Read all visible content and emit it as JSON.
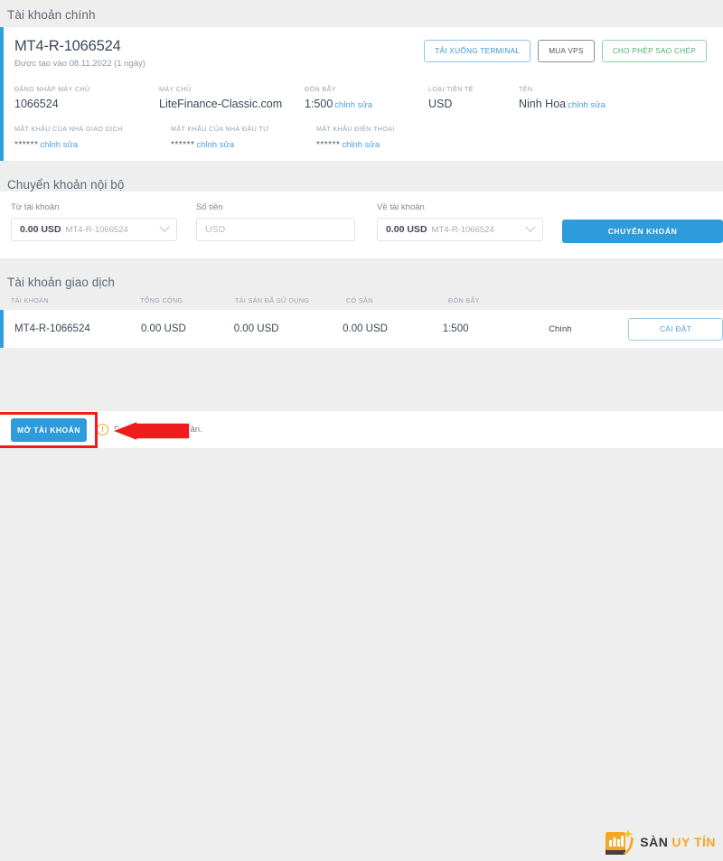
{
  "page": {
    "main_account_title": "Tài khoản chính",
    "transfer_title": "Chuyển khoản nội bộ",
    "accounts_title": "Tài khoản giao dịch"
  },
  "colors": {
    "accent_blue": "#2e9bda",
    "card_border_blue": "#2f9fe0",
    "link_blue": "#4a9fe0",
    "green_outline": "#8ed3a6",
    "annotation_red": "#ee1c1c",
    "warning_orange": "#f0a818",
    "brand_orange": "#f5a623"
  },
  "main_account": {
    "account_number": "MT4-R-1066524",
    "created": "Được tạo vào 08.11.2022 (1 ngày)",
    "buttons": [
      {
        "label": "TẢI XUỐNG TERMINAL",
        "style": "blue"
      },
      {
        "label": "MUA VPS",
        "style": "gray"
      },
      {
        "label": "CHO PHÉP SAO CHÉP",
        "style": "green"
      }
    ],
    "fields_row1": [
      {
        "label": "ĐĂNG NHẬP MÁY CHỦ",
        "value": "1066524",
        "edit": ""
      },
      {
        "label": "MÁY CHỦ",
        "value": "LiteFinance-Classic.com",
        "edit": ""
      },
      {
        "label": "ĐÒN BẨY",
        "value": "1:500",
        "edit": "chỉnh sửa"
      },
      {
        "label": "LOẠI TIỀN TỆ",
        "value": "USD",
        "edit": ""
      },
      {
        "label": "TÊN",
        "value": "Ninh Hoa",
        "edit": "chỉnh sửa"
      }
    ],
    "fields_row2": [
      {
        "label": "MẬT KHẨU CỦA NHÀ GIAO DỊCH",
        "value": "******",
        "edit": "chỉnh sửa"
      },
      {
        "label": "MẬT KHẨU CỦA NHÀ ĐẦU TƯ",
        "value": "******",
        "edit": "chỉnh sửa"
      },
      {
        "label": "MẬT KHẨU ĐIỆN THOẠI",
        "value": "******",
        "edit": "chỉnh sửa"
      }
    ]
  },
  "transfer": {
    "from_label": "Từ tài khoản",
    "from_amount": "0.00 USD",
    "from_account": "MT4-R-1066524",
    "amount_label": "Số tiền",
    "amount_placeholder": "USD",
    "amount_value": "",
    "to_label": "Về tài khoản",
    "to_amount": "0.00 USD",
    "to_account": "MT4-R-1066524",
    "submit_label": "CHUYỂN KHOẢN"
  },
  "accounts_table": {
    "columns": [
      "TÀI KHOẢN",
      "TỔNG CỘNG",
      "TÀI SẢN ĐÃ SỬ DỤNG",
      "CÓ SẴN",
      "ĐÒN BẨY"
    ],
    "rows": [
      {
        "account": "MT4-R-1066524",
        "total": "0.00 USD",
        "used": "0.00 USD",
        "available": "0.00 USD",
        "leverage": "1:500",
        "type": "Chính",
        "action": "CÀI ĐẶT"
      }
    ]
  },
  "footer": {
    "open_account_label": "MỞ TÀI KHOẢN",
    "warning_icon": "!",
    "note": "Bạn chưa có tài khoản."
  },
  "brand": {
    "name_part1": "SÀN",
    "name_part2": "UY TÍN"
  }
}
